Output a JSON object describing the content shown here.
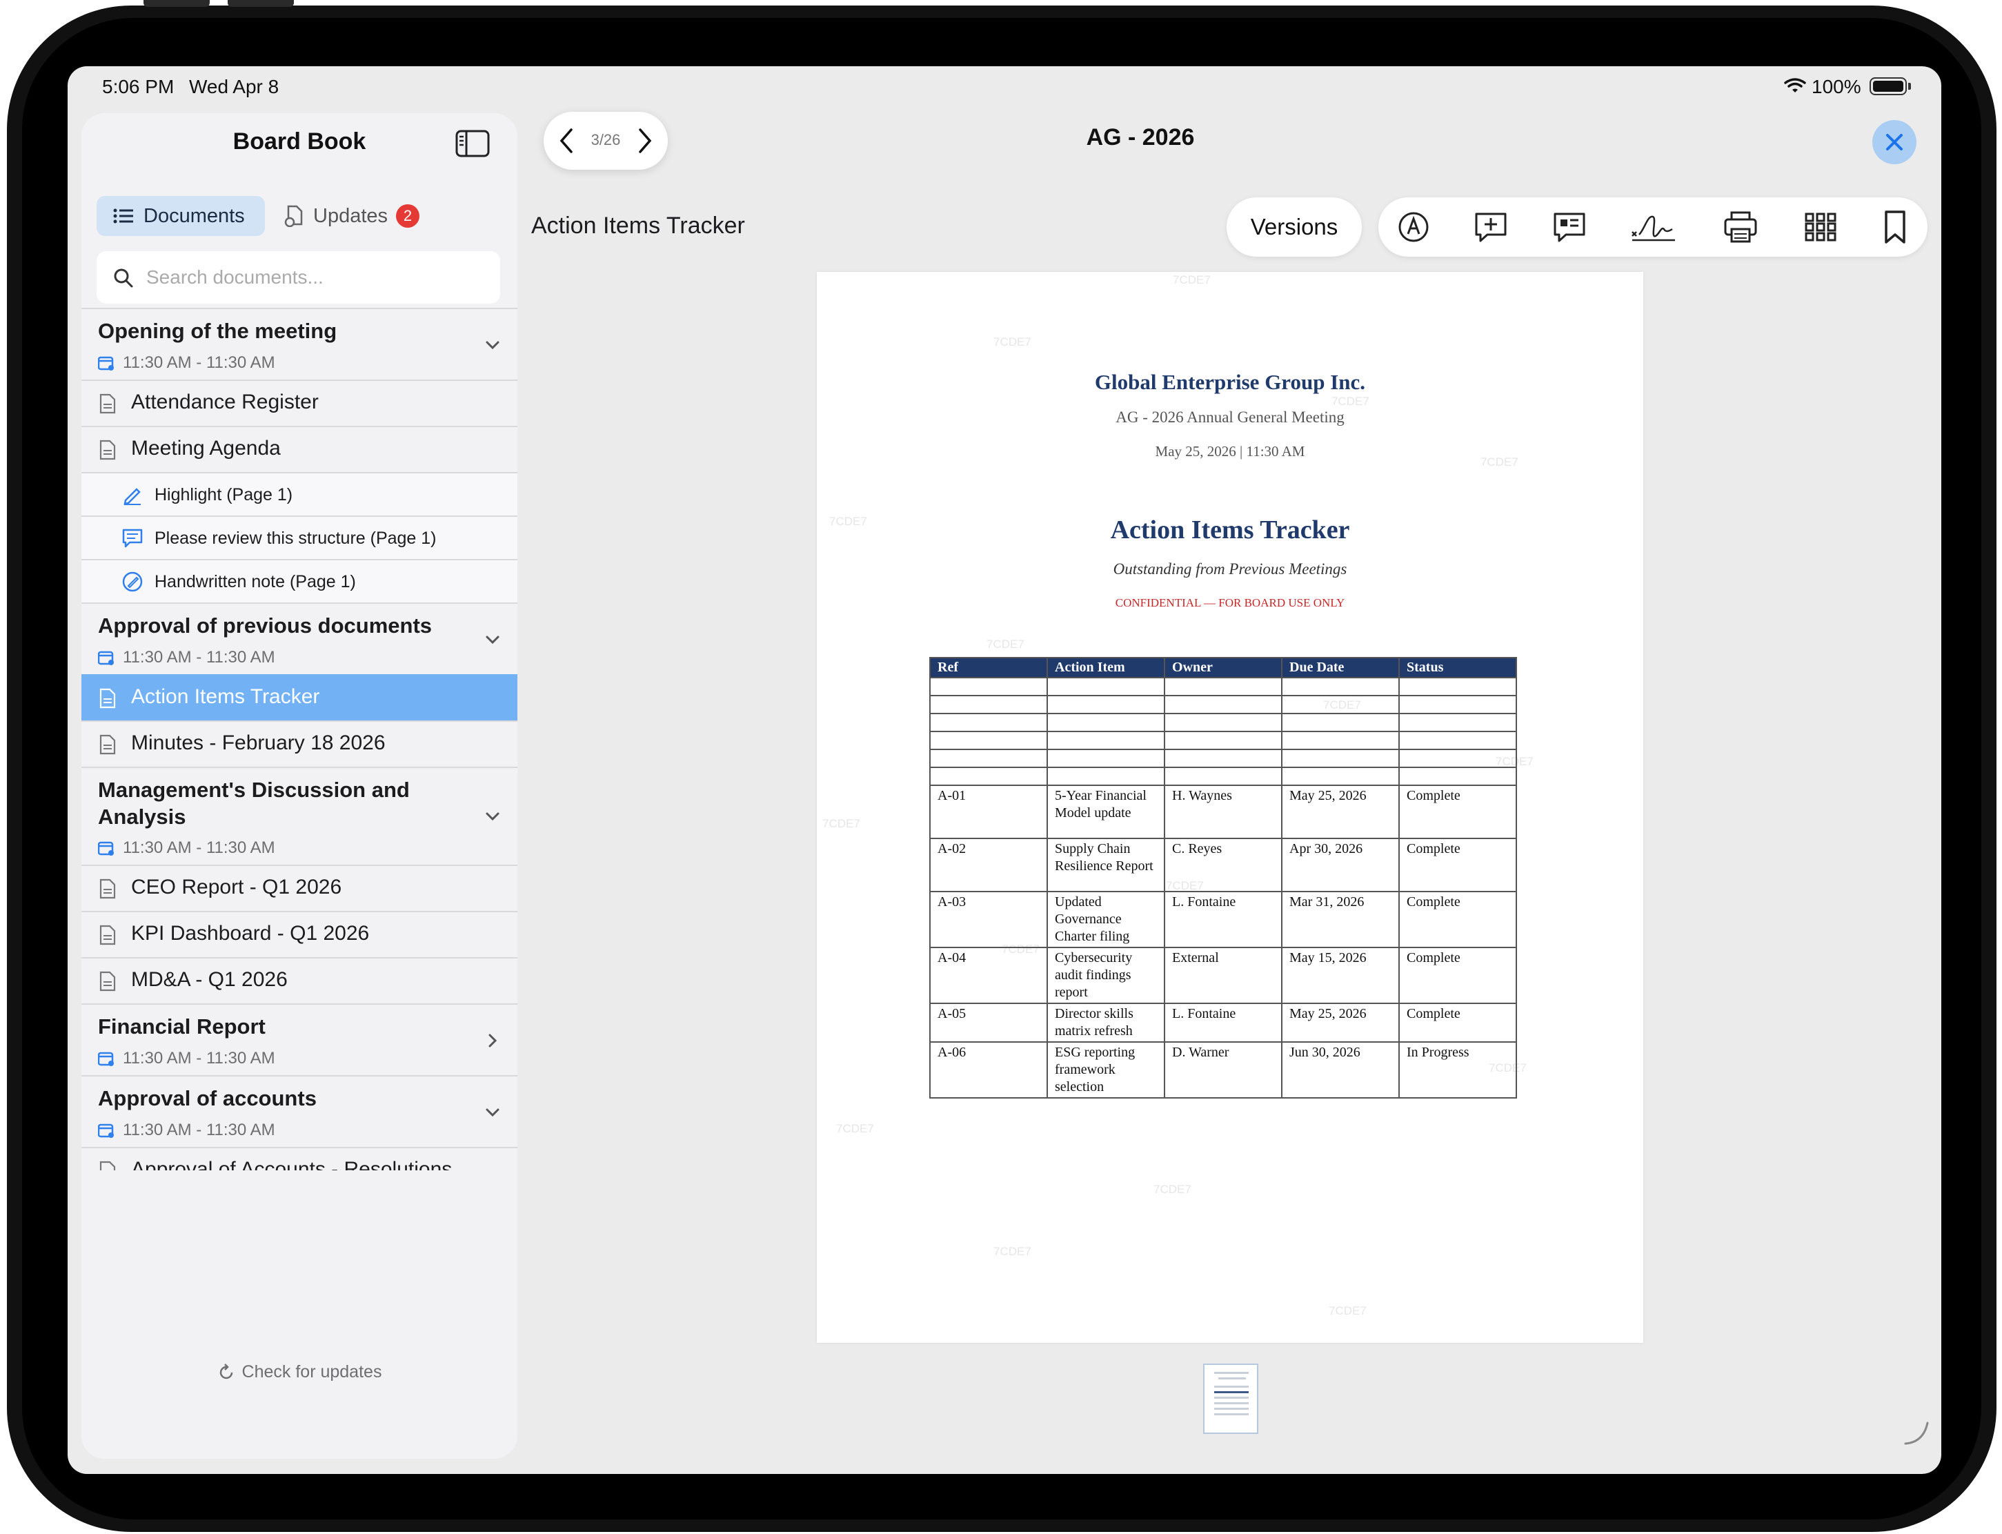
{
  "status_bar": {
    "time": "5:06 PM",
    "date": "Wed Apr 8",
    "battery": "100%"
  },
  "sidebar": {
    "title": "Board Book",
    "tabs": {
      "documents": "Documents",
      "updates": "Updates",
      "updates_badge": "2"
    },
    "search_placeholder": "Search documents...",
    "sections": [
      {
        "title": "Opening of the meeting",
        "time": "11:30 AM - 11:30 AM",
        "items": [
          {
            "label": "Attendance Register"
          },
          {
            "label": "Meeting Agenda"
          }
        ],
        "annotations": [
          {
            "label": "Highlight (Page 1)",
            "icon": "highlighter-icon"
          },
          {
            "label": "Please review this structure (Page 1)",
            "icon": "comment-icon"
          },
          {
            "label": "Handwritten note (Page 1)",
            "icon": "pen-note-icon"
          }
        ]
      },
      {
        "title": "Approval of previous documents",
        "time": "11:30 AM - 11:30 AM",
        "items": [
          {
            "label": "Action Items Tracker",
            "selected": true
          },
          {
            "label": "Minutes - February 18 2026"
          }
        ]
      },
      {
        "title": "Management's Discussion and Analysis",
        "time": "11:30 AM - 11:30 AM",
        "items": [
          {
            "label": "CEO Report - Q1 2026"
          },
          {
            "label": "KPI Dashboard - Q1 2026"
          },
          {
            "label": "MD&A - Q1 2026"
          }
        ]
      },
      {
        "title": "Financial Report",
        "time": "11:30 AM - 11:30 AM",
        "collapsed": true
      },
      {
        "title": "Approval of accounts",
        "time": "11:30 AM - 11:30 AM",
        "items": [
          {
            "label": "Approval of Accounts - Resolutions"
          }
        ]
      }
    ],
    "check_updates": "Check for updates"
  },
  "viewer": {
    "page_indicator": "3/26",
    "meeting_title": "AG - 2026",
    "document_title": "Action Items Tracker",
    "versions_label": "Versions",
    "toolbar_icons": [
      "markup-icon",
      "add-comment-icon",
      "comments-list-icon",
      "signature-icon",
      "print-icon",
      "grid-icon",
      "bookmark-icon"
    ]
  },
  "document_page": {
    "company": "Global Enterprise Group Inc.",
    "meeting": "AG - 2026 Annual General Meeting",
    "datetime": "May 25, 2026  |  11:30 AM",
    "heading": "Action Items Tracker",
    "subheading": "Outstanding from Previous Meetings",
    "confidential": "CONFIDENTIAL — FOR BOARD USE ONLY",
    "watermark": "7CDE7",
    "table": {
      "headers": [
        "Ref",
        "Action Item",
        "Owner",
        "Due Date",
        "Status"
      ],
      "rows": [
        [
          "A-01",
          "5-Year Financial Model update",
          "H. Waynes",
          "May 25, 2026",
          "Complete"
        ],
        [
          "A-02",
          "Supply Chain Resilience Report",
          "C. Reyes",
          "Apr 30, 2026",
          "Complete"
        ],
        [
          "A-03",
          "Updated Governance Charter filing",
          "L. Fontaine",
          "Mar 31, 2026",
          "Complete"
        ],
        [
          "A-04",
          "Cybersecurity audit findings report",
          "External",
          "May 15, 2026",
          "Complete"
        ],
        [
          "A-05",
          "Director skills matrix refresh",
          "L. Fontaine",
          "May 25, 2026",
          "Complete"
        ],
        [
          "A-06",
          "ESG reporting framework selection",
          "D. Warner",
          "Jun 30, 2026",
          "In Progress"
        ]
      ]
    }
  }
}
